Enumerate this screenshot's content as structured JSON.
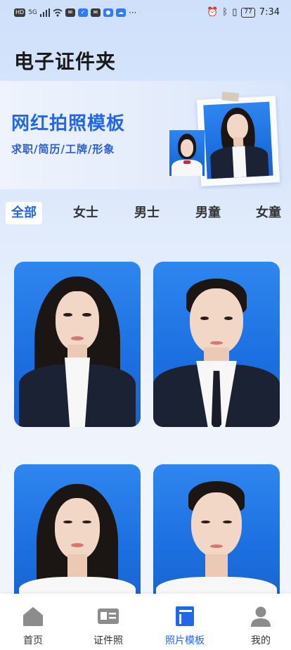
{
  "status_bar": {
    "left_chips": [
      "HD",
      "5G"
    ],
    "dots": "···",
    "battery": "77",
    "time": "7:34"
  },
  "app_title": "电子证件夹",
  "banner": {
    "title": "网红拍照模板",
    "subtitle": "求职/简历/工牌/形象"
  },
  "tabs": [
    {
      "label": "全部",
      "active": true
    },
    {
      "label": "女士",
      "active": false
    },
    {
      "label": "男士",
      "active": false
    },
    {
      "label": "男童",
      "active": false
    },
    {
      "label": "女童",
      "active": false
    }
  ],
  "bottom_nav": [
    {
      "label": "首页",
      "icon": "home-icon",
      "active": false
    },
    {
      "label": "证件照",
      "icon": "id-card-icon",
      "active": false
    },
    {
      "label": "照片模板",
      "icon": "template-icon",
      "active": true
    },
    {
      "label": "我的",
      "icon": "user-icon",
      "active": false
    }
  ],
  "colors": {
    "accent": "#2367e6",
    "photo_background": "#1f72e6",
    "nav_inactive_icon": "#8c8c8c"
  }
}
